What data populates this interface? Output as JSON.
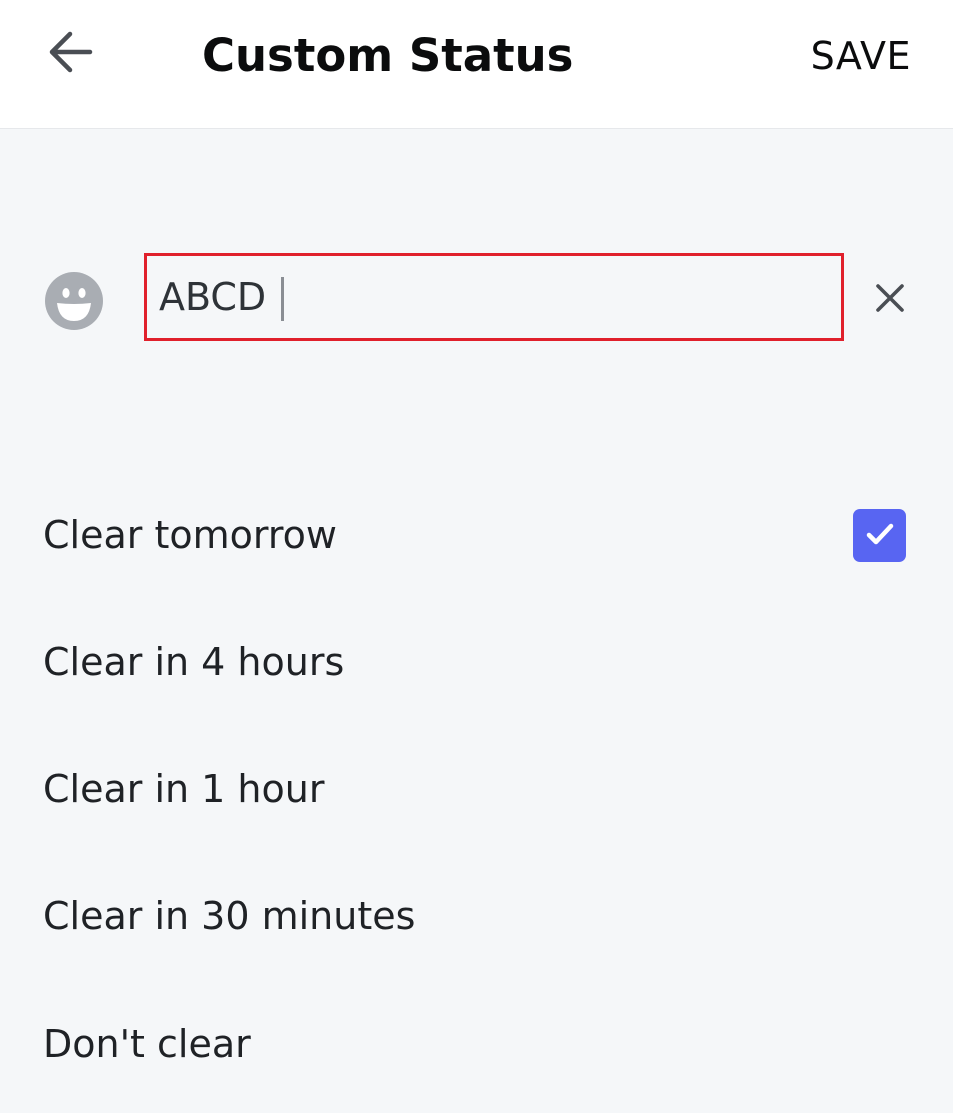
{
  "header": {
    "title": "Custom Status",
    "save_label": "SAVE",
    "back_icon": "arrow-left-icon"
  },
  "status": {
    "emoji_icon": "smiley-face-icon",
    "value": "ABCD",
    "clear_icon": "close-icon",
    "highlight_color": "#e0202c"
  },
  "clear_options": [
    {
      "label": "Clear tomorrow",
      "selected": true
    },
    {
      "label": "Clear in 4 hours",
      "selected": false
    },
    {
      "label": "Clear in 1 hour",
      "selected": false
    },
    {
      "label": "Clear in 30 minutes",
      "selected": false
    },
    {
      "label": "Don't clear",
      "selected": false
    }
  ],
  "colors": {
    "accent": "#5865f2",
    "background": "#f5f7f9",
    "header_background": "#ffffff"
  }
}
